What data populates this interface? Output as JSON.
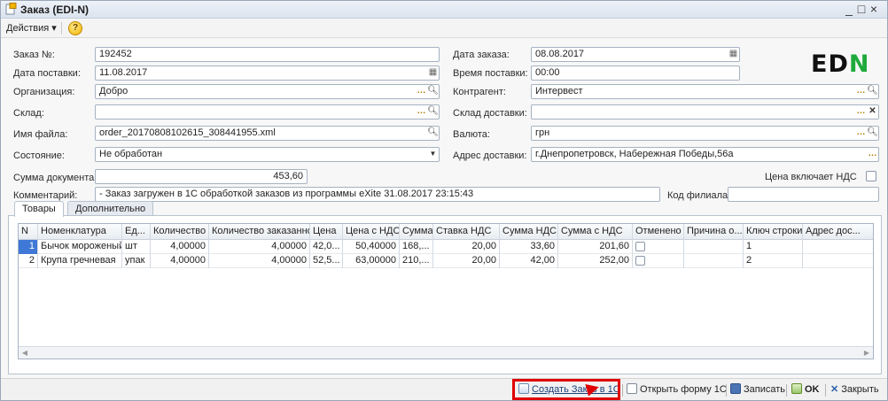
{
  "window": {
    "title": "Заказ (EDI-N)",
    "controls": [
      "_",
      "□",
      "×"
    ]
  },
  "actionbar": {
    "actions_label": "Действия ▾",
    "help_label": "?"
  },
  "form": {
    "order_no_label": "Заказ №:",
    "order_no": "192452",
    "order_date_label": "Дата заказа:",
    "order_date": "08.08.2017",
    "delivery_date_label": "Дата поставки:",
    "delivery_date": "11.08.2017",
    "delivery_time_label": "Время поставки:",
    "delivery_time": "00:00",
    "org_label": "Организация:",
    "org": "Добро",
    "counterparty_label": "Контрагент:",
    "counterparty": "Интервест",
    "warehouse_label": "Склад:",
    "warehouse": "",
    "delivery_wh_label": "Склад доставки:",
    "delivery_wh": "",
    "filename_label": "Имя файла:",
    "filename": "order_20170808102615_308441955.xml",
    "currency_label": "Валюта:",
    "currency": "грн",
    "status_label": "Состояние:",
    "status": "Не обработан",
    "address_label": "Адрес доставки:",
    "address": "г.Днепропетровск, Набережная Победы,56а",
    "sum_label": "Сумма документа:",
    "sum": "453,60",
    "vat_included_label": "Цена включает НДС",
    "comment_label": "Комментарий:",
    "comment": "  - Заказ загружен в 1С обработкой заказов из программы eXite 31.08.2017 23:15:43",
    "branch_code_label": "Код филиала:",
    "branch_code": ""
  },
  "logo": {
    "text_a": "ED",
    "text_b": "N"
  },
  "tabs": [
    "Товары",
    "Дополнительно"
  ],
  "table": {
    "headers": [
      "N",
      "Номенклатура",
      "Ед...",
      "Количество",
      "Количество заказанное",
      "Цена",
      "Цена с НДС",
      "Сумма",
      "Ставка НДС",
      "Сумма НДС",
      "Сумма с НДС",
      "Отменено",
      "Причина о...",
      "Ключ строки",
      "Адрес дос..."
    ],
    "rows": [
      [
        "1",
        "Бычок мороженый",
        "шт",
        "4,00000",
        "4,00000",
        "42,0...",
        "50,40000",
        "168,...",
        "20,00",
        "33,60",
        "201,60",
        "",
        "",
        "1",
        ""
      ],
      [
        "2",
        "Крупа гречневая",
        "упак",
        "4,00000",
        "4,00000",
        "52,5...",
        "63,00000",
        "210,...",
        "20,00",
        "42,00",
        "252,00",
        "",
        "",
        "2",
        ""
      ]
    ]
  },
  "bottombar": {
    "create_order": "Создать Заказ в 1С",
    "open_form": "Открыть форму 1С",
    "save": "Записать",
    "ok": "OK",
    "close": "Закрыть"
  },
  "colors": {
    "accent": "#3f78d6",
    "logo_green": "#1faa3c",
    "highlight": "#e00000"
  }
}
